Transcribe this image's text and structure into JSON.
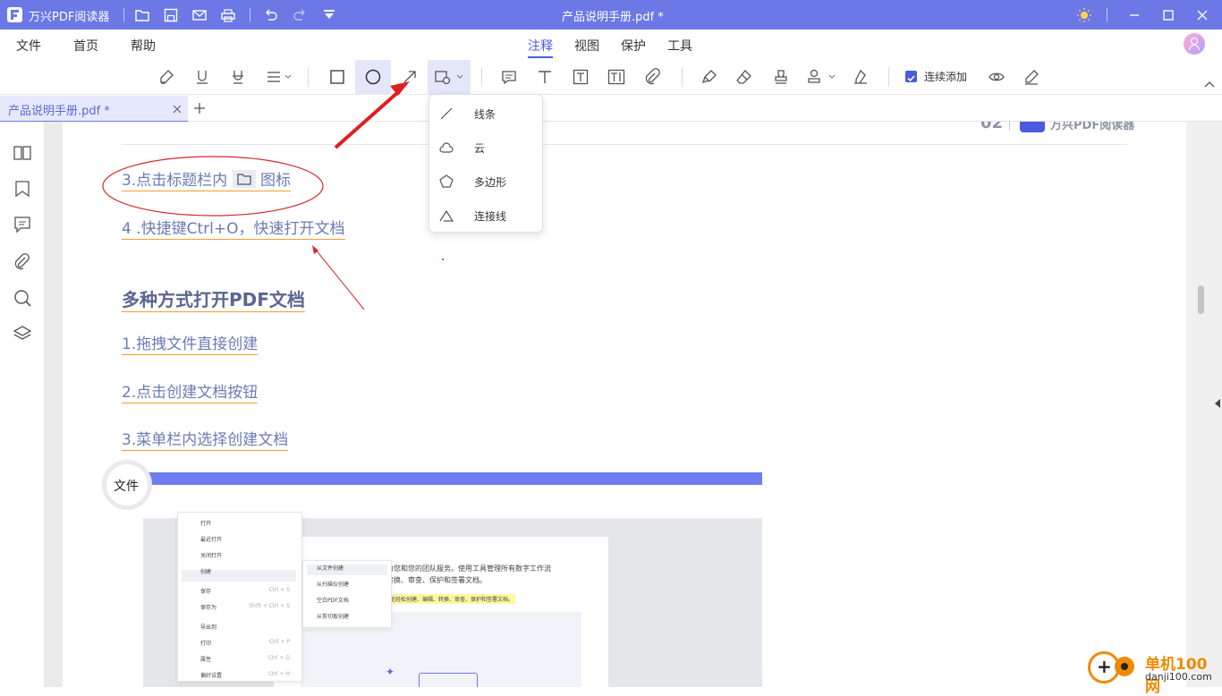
{
  "app": {
    "name": "万兴PDF阅读器",
    "title": "产品说明手册.pdf *"
  },
  "menu": {
    "file": "文件",
    "home": "首页",
    "help": "帮助",
    "annotate": "注释",
    "view": "视图",
    "protect": "保护",
    "tools": "工具"
  },
  "toolbar": {
    "continuous_add": "连续添加",
    "continuous_checked": true
  },
  "tab": {
    "label": "产品说明手册.pdf *"
  },
  "shape_menu": {
    "items": [
      "线条",
      "云",
      "多边形",
      "连接线"
    ]
  },
  "page": {
    "header_page": "02",
    "header_brand": "万兴PDF阅读器",
    "line3_before": "3.点击标题栏内",
    "line3_after": "图标",
    "line4": "4 .快捷键Ctrl+O，快速打开文档",
    "heading": "多种方式打开PDF文档",
    "step1": "1.拖拽文件直接创建",
    "step2": "2.点击创建文档按钮",
    "step3": "3.菜单栏内选择创建文档",
    "callout": "文件"
  },
  "screenshot": {
    "menu_items": [
      "打开",
      "最近打开",
      "关闭打开",
      "创建",
      "保存",
      "保存为",
      "导出到",
      "打印",
      "属性",
      "偏好设置"
    ],
    "shortcuts": {
      "save": "Ctrl + S",
      "save_as": "Shift + Ctrl + S",
      "print": "Ctrl + P",
      "properties": "Ctrl + D",
      "prefs": "Ctrl + H"
    },
    "submenu": [
      "从文件创建",
      "从扫描仪创建",
      "空白PDF文档",
      "从剪切板创建"
    ],
    "text_line1": "当今工作的需求。为您和您的团队服务。使用工具管理所有数字工作流",
    "text_line2": "轻松创建、编辑、转换、审查、保护和签署文档。",
    "highlight": "所有数字工作流程，在一处轻松创建、编辑、转换、审查、保护和签署文档。"
  },
  "watermark": {
    "title": "单机100网",
    "url": "danji100.com"
  }
}
